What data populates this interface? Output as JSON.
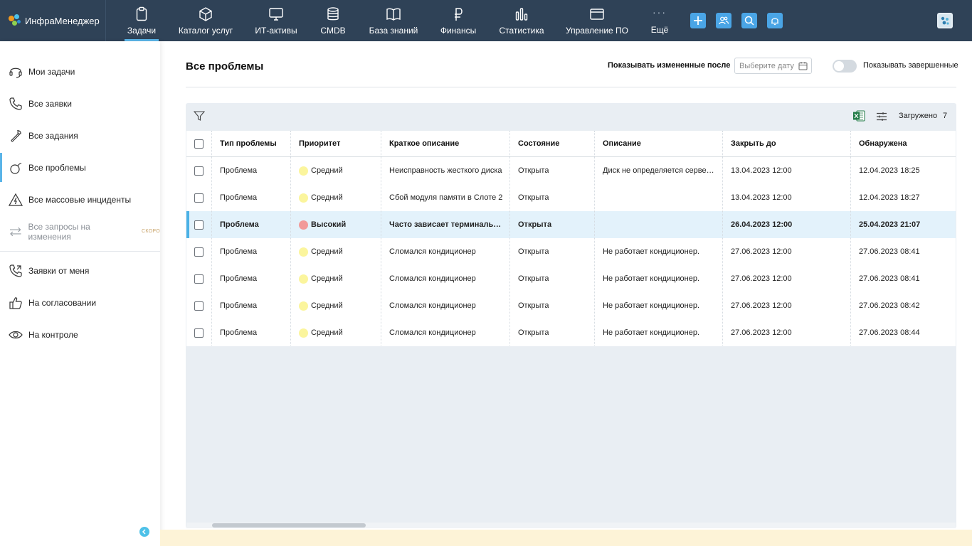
{
  "app": {
    "logo_text": "ИнфраМенеджер",
    "accent_color": "#5ab4e8",
    "topbar_color": "#2f4257"
  },
  "nav": {
    "items": [
      {
        "label": "Задачи",
        "icon": "clipboard-icon",
        "active": true
      },
      {
        "label": "Каталог услуг",
        "icon": "cube-icon"
      },
      {
        "label": "ИТ-активы",
        "icon": "monitor-icon"
      },
      {
        "label": "CMDB",
        "icon": "database-icon"
      },
      {
        "label": "База знаний",
        "icon": "book-icon"
      },
      {
        "label": "Финансы",
        "icon": "ruble-icon"
      },
      {
        "label": "Статистика",
        "icon": "bar-chart-icon"
      },
      {
        "label": "Управление ПО",
        "icon": "window-icon"
      },
      {
        "label": "Ещё",
        "icon": "more-icon"
      }
    ],
    "more_dots": "···",
    "actions": [
      "plus-icon",
      "users-icon",
      "search-icon",
      "bell-icon",
      "user-avatar-icon"
    ]
  },
  "sidebar": {
    "items": [
      {
        "label": "Мои задачи",
        "icon": "headset-icon"
      },
      {
        "label": "Все заявки",
        "icon": "phone-icon"
      },
      {
        "label": "Все задания",
        "icon": "wrench-icon"
      },
      {
        "label": "Все проблемы",
        "icon": "bomb-icon",
        "active": true
      },
      {
        "label": "Все массовые инциденты",
        "icon": "warning-bolt-icon"
      },
      {
        "label": "Все запросы на изменения",
        "icon": "swap-arrows-icon",
        "disabled": true,
        "badge": "СКОРО"
      },
      {
        "label": "Заявки от меня",
        "icon": "phone-out-icon"
      },
      {
        "label": "На согласовании",
        "icon": "thumbs-up-icon"
      },
      {
        "label": "На контроле",
        "icon": "eye-icon"
      }
    ]
  },
  "page": {
    "title": "Все проблемы",
    "changed_after_label": "Показывать измененные после",
    "date_placeholder": "Выберите дату",
    "show_completed_label": "Показывать завершенные",
    "show_completed": false
  },
  "grid": {
    "loaded_label": "Загружено",
    "loaded_count": "7",
    "columns": [
      "Тип проблемы",
      "Приоритет",
      "Краткое описание",
      "Состояние",
      "Описание",
      "Закрыть до",
      "Обнаружена"
    ],
    "rows": [
      {
        "type": "Проблема",
        "priority": "Средний",
        "priority_color": "#fbf59d",
        "summary": "Неисправность жесткого диска",
        "state": "Открыта",
        "description": "Диск не определяется сервером",
        "due": "13.04.2023 12:00",
        "detected": "12.04.2023 18:25"
      },
      {
        "type": "Проблема",
        "priority": "Средний",
        "priority_color": "#fbf59d",
        "summary": "Сбой модуля памяти в Слоте 2",
        "state": "Открыта",
        "description": "",
        "due": "13.04.2023 12:00",
        "detected": "12.04.2023 18:27"
      },
      {
        "type": "Проблема",
        "priority": "Высокий",
        "priority_color": "#f29a9a",
        "summary": "Часто зависает терминальный сервер",
        "state": "Открыта",
        "description": "",
        "due": "26.04.2023 12:00",
        "detected": "25.04.2023 21:07",
        "selected": true
      },
      {
        "type": "Проблема",
        "priority": "Средний",
        "priority_color": "#fbf59d",
        "summary": "Сломался кондиционер",
        "state": "Открыта",
        "description": "Не работает кондиционер.",
        "due": "27.06.2023 12:00",
        "detected": "27.06.2023 08:41"
      },
      {
        "type": "Проблема",
        "priority": "Средний",
        "priority_color": "#fbf59d",
        "summary": "Сломался кондиционер",
        "state": "Открыта",
        "description": "Не работает кондиционер.",
        "due": "27.06.2023 12:00",
        "detected": "27.06.2023 08:41"
      },
      {
        "type": "Проблема",
        "priority": "Средний",
        "priority_color": "#fbf59d",
        "summary": "Сломался кондиционер",
        "state": "Открыта",
        "description": "Не работает кондиционер.",
        "due": "27.06.2023 12:00",
        "detected": "27.06.2023 08:42"
      },
      {
        "type": "Проблема",
        "priority": "Средний",
        "priority_color": "#fbf59d",
        "summary": "Сломался кондиционер",
        "state": "Открыта",
        "description": "Не работает кондиционер.",
        "due": "27.06.2023 12:00",
        "detected": "27.06.2023 08:44"
      }
    ]
  }
}
